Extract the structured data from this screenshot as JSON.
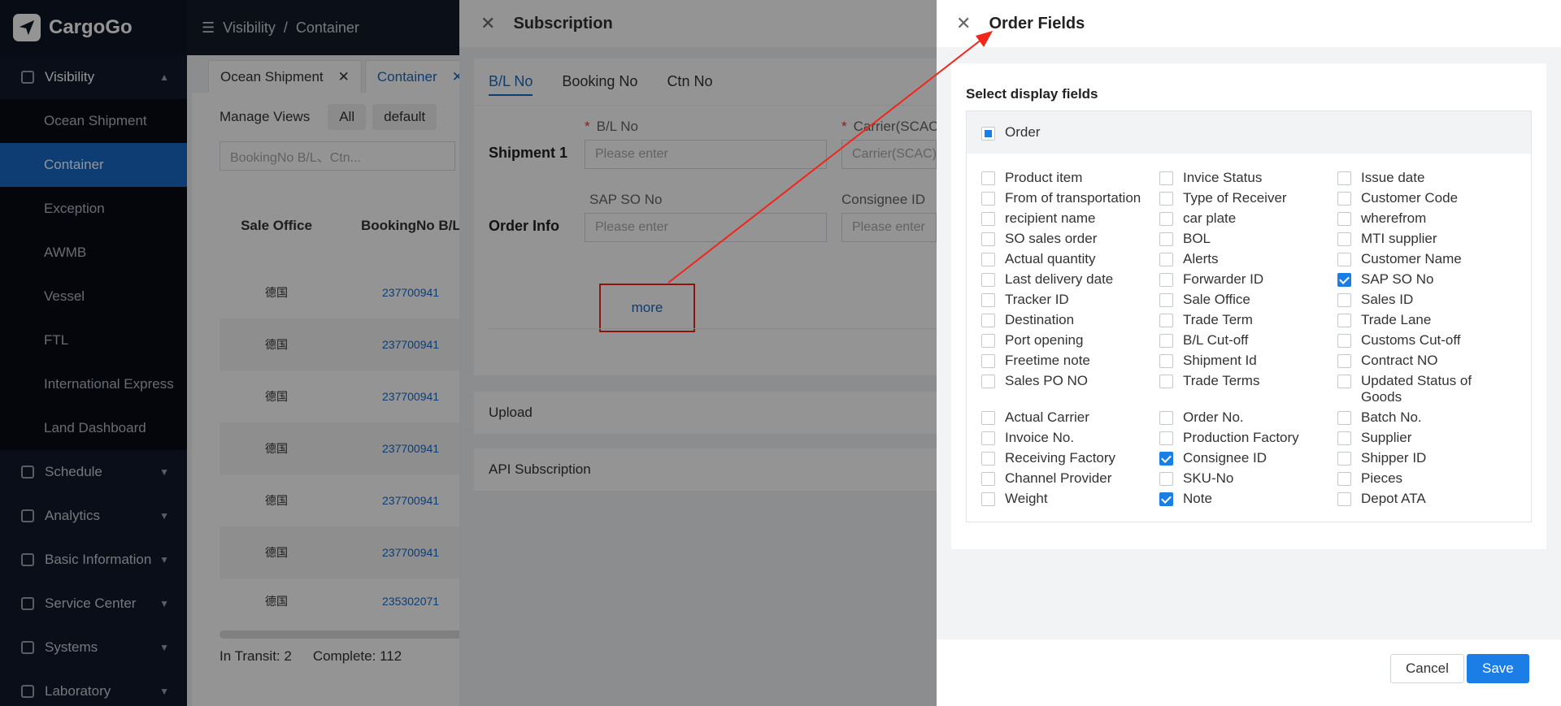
{
  "app": {
    "name": "CargoGo"
  },
  "breadcrumb": {
    "section": "Visibility",
    "separator": "/",
    "page": "Container"
  },
  "sidebar": {
    "visibility_label": "Visibility",
    "visibility_items": [
      "Ocean Shipment",
      "Container",
      "Exception",
      "AWMB",
      "Vessel",
      "FTL",
      "International Express",
      "Land Dashboard"
    ],
    "groups": [
      "Schedule",
      "Analytics",
      "Basic Information",
      "Service Center",
      "Systems",
      "Laboratory"
    ]
  },
  "main": {
    "tabs": [
      "Ocean Shipment",
      "Container"
    ],
    "views": {
      "manage": "Manage Views",
      "all": "All",
      "default": "default"
    },
    "search_placeholder": "BookingNo B/L、Ctn...",
    "columns": [
      "Sale Office",
      "BookingNo B/L"
    ],
    "rows": [
      {
        "office": "德国",
        "booking": "237700941"
      },
      {
        "office": "德国",
        "booking": "237700941"
      },
      {
        "office": "德国",
        "booking": "237700941"
      },
      {
        "office": "德国",
        "booking": "237700941"
      },
      {
        "office": "德国",
        "booking": "237700941"
      },
      {
        "office": "德国",
        "booking": "237700941"
      },
      {
        "office": "德国",
        "booking": "235302071"
      }
    ],
    "footer": {
      "in_transit": "In Transit:  2",
      "complete": "Complete:  112"
    }
  },
  "subscription": {
    "title": "Subscription",
    "tabs": [
      "B/L No",
      "Booking No",
      "Ctn No"
    ],
    "shipment_label": "Shipment 1",
    "order_label": "Order Info",
    "bl_label": "B/L No",
    "carrier_label": "Carrier(SCAC)",
    "carrier_placeholder": "Carrier(SCAC)",
    "sap_label": "SAP SO No",
    "consignee_label": "Consignee ID",
    "placeholder": "Please enter",
    "more": "more",
    "upload": "Upload",
    "api": "API Subscription"
  },
  "order_fields": {
    "title": "Order Fields",
    "heading": "Select display fields",
    "group_label": "Order",
    "columns": [
      [
        {
          "label": "Product item",
          "checked": false
        },
        {
          "label": "From of transportation",
          "checked": false
        },
        {
          "label": "recipient name",
          "checked": false
        },
        {
          "label": "SO sales order",
          "checked": false
        },
        {
          "label": "Actual quantity",
          "checked": false
        },
        {
          "label": "Last delivery date",
          "checked": false
        },
        {
          "label": "Tracker ID",
          "checked": false
        },
        {
          "label": "Destination",
          "checked": false
        },
        {
          "label": "Port opening",
          "checked": false
        },
        {
          "label": "Freetime note",
          "checked": false
        },
        {
          "label": "Sales PO NO",
          "checked": false
        },
        {
          "label": "Actual Carrier",
          "checked": false
        },
        {
          "label": "Invoice No.",
          "checked": false
        },
        {
          "label": "Receiving Factory",
          "checked": false
        },
        {
          "label": "Channel Provider",
          "checked": false
        },
        {
          "label": "Weight",
          "checked": false
        }
      ],
      [
        {
          "label": "Invice Status",
          "checked": false
        },
        {
          "label": "Type of Receiver",
          "checked": false
        },
        {
          "label": "car plate",
          "checked": false
        },
        {
          "label": "BOL",
          "checked": false
        },
        {
          "label": "Alerts",
          "checked": false
        },
        {
          "label": "Forwarder ID",
          "checked": false
        },
        {
          "label": "Sale Office",
          "checked": false
        },
        {
          "label": "Trade Term",
          "checked": false
        },
        {
          "label": "B/L Cut-off",
          "checked": false
        },
        {
          "label": "Shipment Id",
          "checked": false
        },
        {
          "label": "Trade Terms",
          "checked": false
        },
        {
          "label": "Order No.",
          "checked": false
        },
        {
          "label": "Production Factory",
          "checked": false
        },
        {
          "label": "Consignee ID",
          "checked": true
        },
        {
          "label": "SKU-No",
          "checked": false
        },
        {
          "label": "Note",
          "checked": true
        }
      ],
      [
        {
          "label": "Issue date",
          "checked": false
        },
        {
          "label": "Customer Code",
          "checked": false
        },
        {
          "label": "wherefrom",
          "checked": false
        },
        {
          "label": "MTI supplier",
          "checked": false
        },
        {
          "label": "Customer Name",
          "checked": false
        },
        {
          "label": "SAP SO No",
          "checked": true
        },
        {
          "label": "Sales ID",
          "checked": false
        },
        {
          "label": "Trade Lane",
          "checked": false
        },
        {
          "label": "Customs Cut-off",
          "checked": false
        },
        {
          "label": "Contract NO",
          "checked": false
        },
        {
          "label": "Updated Status of Goods",
          "checked": false
        },
        {
          "label": "Batch No.",
          "checked": false
        },
        {
          "label": "Supplier",
          "checked": false
        },
        {
          "label": "Shipper ID",
          "checked": false
        },
        {
          "label": "Pieces",
          "checked": false
        },
        {
          "label": "Depot ATA",
          "checked": false
        }
      ]
    ],
    "cancel": "Cancel",
    "save": "Save"
  },
  "colors": {
    "primary": "#1a7ee6",
    "sidebar": "#0e1523",
    "annotation": "#f0261a"
  }
}
